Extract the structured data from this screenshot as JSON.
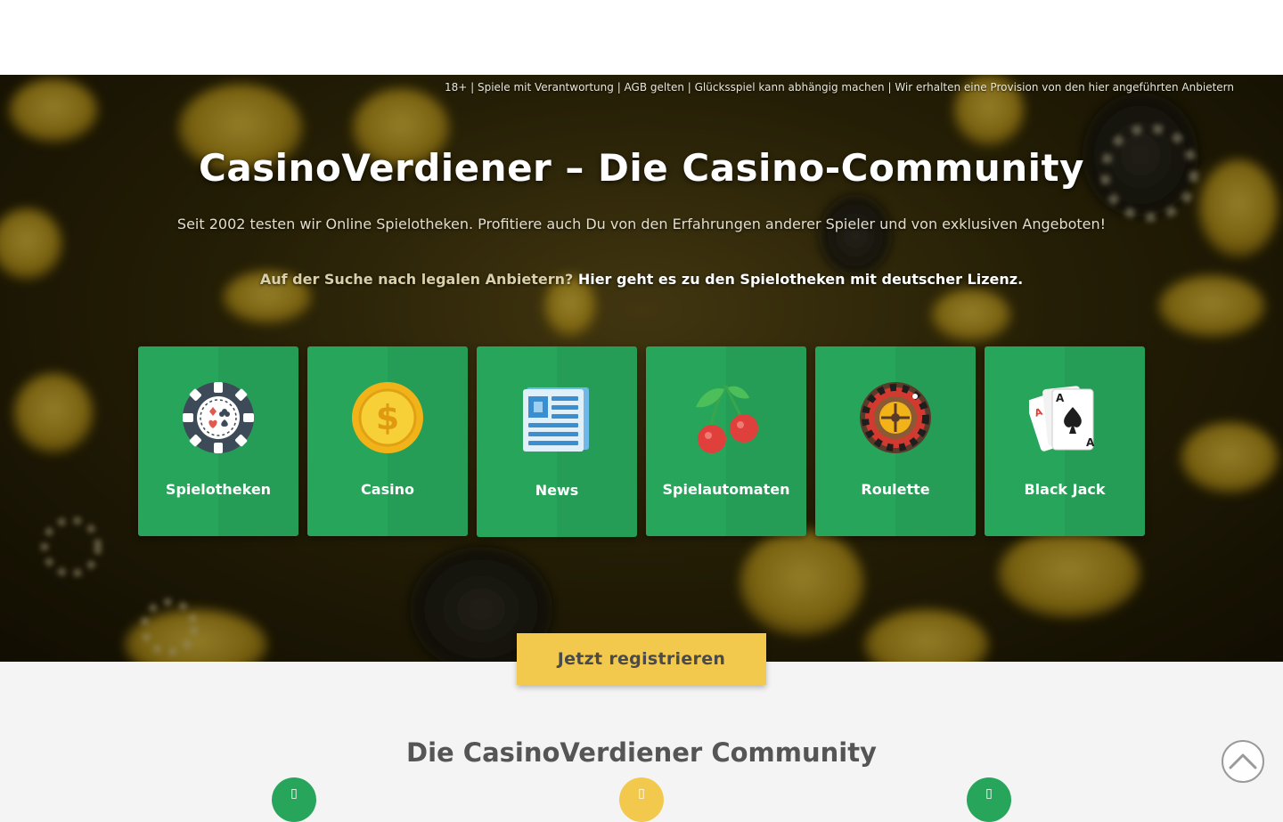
{
  "hero": {
    "disclaimer": "18+ | Spiele mit Verantwortung | AGB gelten | Glücksspiel kann abhängig machen | Wir erhalten eine Provision von den hier angeführten Anbietern",
    "title": "CasinoVerdiener – Die Casino-Community",
    "subtitle": "Seit 2002 testen wir Online Spielotheken. Profitiere auch Du von den Erfahrungen anderer Spieler und von exklusiven Angeboten!",
    "legal_question": "Auf der Suche nach legalen Anbietern?",
    "legal_link": "Hier geht es zu den Spielotheken mit deutscher Lizenz."
  },
  "categories": [
    {
      "label": "Spielotheken",
      "icon": "poker-chip-icon"
    },
    {
      "label": "Casino",
      "icon": "gold-coin-icon"
    },
    {
      "label": "News",
      "icon": "newspaper-icon"
    },
    {
      "label": "Spielautomaten",
      "icon": "cherries-icon"
    },
    {
      "label": "Roulette",
      "icon": "roulette-wheel-icon"
    },
    {
      "label": "Black Jack",
      "icon": "playing-cards-icon"
    }
  ],
  "cta": {
    "register_label": "Jetzt registrieren"
  },
  "community": {
    "title": "Die CasinoVerdiener Community",
    "features": [
      {
        "icon": "feature-icon",
        "color": "#27a65b"
      },
      {
        "icon": "feature-icon",
        "color": "#f2c94c"
      },
      {
        "icon": "feature-icon",
        "color": "#27a65b"
      }
    ]
  },
  "colors": {
    "accent_green": "#27a65b",
    "accent_yellow": "#f2c94c",
    "text_gray": "#555555"
  }
}
